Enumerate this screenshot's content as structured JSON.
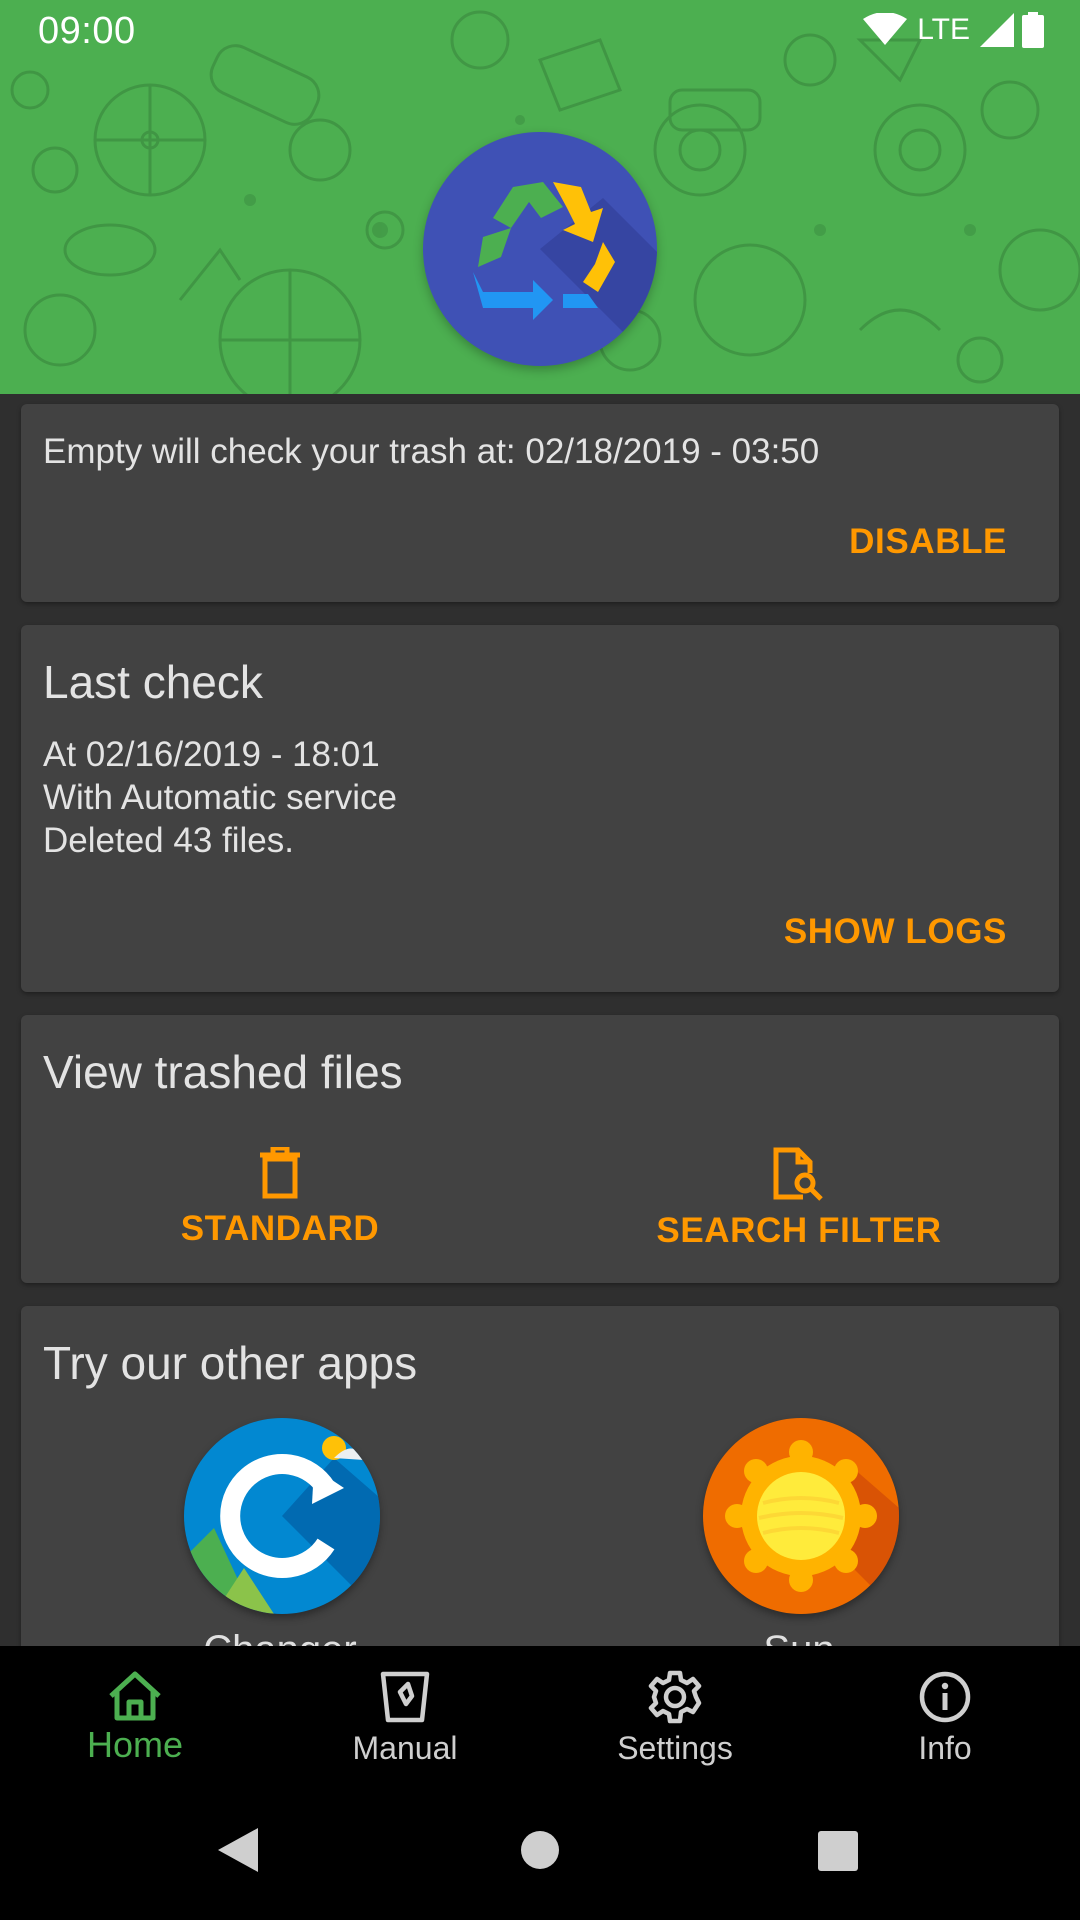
{
  "status_bar": {
    "time": "09:00",
    "network": "LTE",
    "icons": [
      "wifi-icon",
      "signal-icon",
      "battery-icon"
    ]
  },
  "header": {
    "logo": "recycle-icon",
    "background_color": "#4caf50",
    "logo_color": "#3f51b5"
  },
  "schedule_card": {
    "text": "Empty will check your trash at: 02/18/2019 - 03:50",
    "action": "DISABLE"
  },
  "last_check_card": {
    "title": "Last check",
    "lines": [
      "At 02/16/2019 - 18:01",
      "With Automatic service",
      "Deleted 43 files."
    ],
    "action": "SHOW LOGS"
  },
  "trashed_card": {
    "title": "View trashed files",
    "buttons": [
      {
        "label": "STANDARD",
        "icon": "trash-icon"
      },
      {
        "label": "SEARCH FILTER",
        "icon": "file-search-icon"
      }
    ]
  },
  "apps_card": {
    "title": "Try our other apps",
    "apps": [
      {
        "name": "Changer",
        "icon": "changer-app-icon"
      },
      {
        "name": "Sun",
        "icon": "sun-app-icon"
      }
    ]
  },
  "bottom_nav": {
    "items": [
      {
        "label": "Home",
        "icon": "home-icon",
        "active": true
      },
      {
        "label": "Manual",
        "icon": "manual-icon",
        "active": false
      },
      {
        "label": "Settings",
        "icon": "gear-icon",
        "active": false
      },
      {
        "label": "Info",
        "icon": "info-icon",
        "active": false
      }
    ]
  },
  "colors": {
    "accent": "#ff9800",
    "active_nav": "#4caf50",
    "card": "#424242",
    "background": "#2f2f2f"
  }
}
